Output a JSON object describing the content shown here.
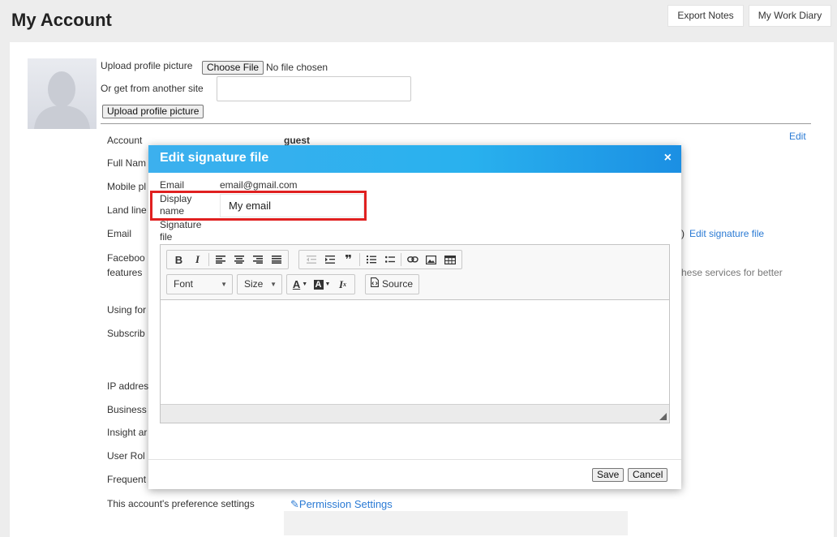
{
  "page": {
    "title": "My Account",
    "export_notes": "Export Notes",
    "work_diary": "My Work Diary"
  },
  "profile": {
    "upload_label": "Upload profile picture",
    "choose_file": "Choose File",
    "no_file": "No file chosen",
    "other_site_label": "Or get from another site",
    "other_site_value": "",
    "upload_button": "Upload profile picture"
  },
  "account": {
    "edit_link": "Edit",
    "rows": [
      {
        "label": "Account",
        "value": "guest"
      },
      {
        "label": "Full Nam"
      },
      {
        "label": "Mobile pl"
      },
      {
        "label": "Land line"
      },
      {
        "label": "Email",
        "after": ")",
        "link": "Edit signature file"
      },
      {
        "label": "Faceboo",
        "label2": "features",
        "after": "hese services for better"
      },
      {
        "label": "Using for"
      },
      {
        "label": "Subscrib"
      },
      {
        "label": "IP addres"
      },
      {
        "label": "Business"
      },
      {
        "label": "Insight ar"
      },
      {
        "label": "User Rol"
      },
      {
        "label": "Frequent"
      },
      {
        "label": "This account's preference settings",
        "link": "Permission Settings"
      }
    ]
  },
  "dialog": {
    "title": "Edit signature file",
    "close": "×",
    "email_label": "Email",
    "email_value": "email@gmail.com",
    "display_label_1": "Display",
    "display_label_2": "name",
    "display_value": "My email",
    "sig_label_1": "Signature",
    "sig_label_2": "file",
    "font_combo": "Font",
    "size_combo": "Size",
    "source_label": "Source",
    "save": "Save",
    "cancel": "Cancel"
  }
}
